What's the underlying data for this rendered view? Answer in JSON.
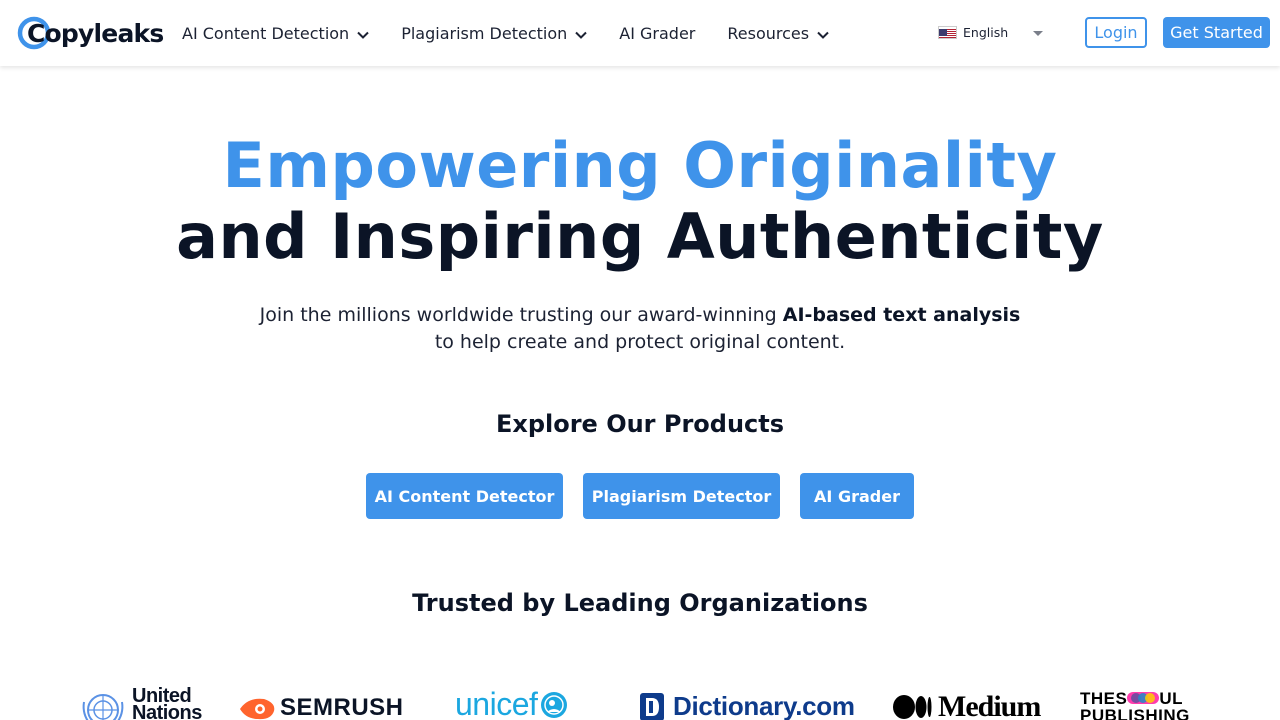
{
  "brand": {
    "name": "Copyleaks",
    "accent_color": "#3f93ea",
    "text_color": "#0b1426"
  },
  "nav": {
    "items": [
      {
        "label": "AI Content Detection",
        "has_dropdown": true,
        "icon": "chevron-down-icon"
      },
      {
        "label": "Plagiarism Detection",
        "has_dropdown": true,
        "icon": "chevron-down-icon"
      },
      {
        "label": "AI Grader",
        "has_dropdown": false
      },
      {
        "label": "Resources",
        "has_dropdown": true,
        "icon": "chevron-down-icon"
      }
    ],
    "language": {
      "label": "English",
      "icon": "us-flag-icon"
    },
    "login_label": "Login",
    "get_started_label": "Get Started"
  },
  "hero": {
    "title_line1": "Empowering Originality",
    "title_line2": "and Inspiring Authenticity",
    "subtitle_pre": "Join the millions worldwide trusting our award-winning ",
    "subtitle_bold": "AI-based text analysis",
    "subtitle_line2": "to help create and protect original content."
  },
  "products": {
    "heading": "Explore Our Products",
    "buttons": [
      {
        "label": "AI Content Detector"
      },
      {
        "label": "Plagiarism Detector"
      },
      {
        "label": "AI Grader"
      }
    ]
  },
  "trusted": {
    "heading": "Trusted by Leading Organizations",
    "logos": [
      {
        "name": "United Nations",
        "line1": "United",
        "line2": "Nations"
      },
      {
        "name": "Semrush",
        "text": "SEMRUSH"
      },
      {
        "name": "UNICEF",
        "text": "unicef"
      },
      {
        "name": "Dictionary.com",
        "text": "Dictionary.com"
      },
      {
        "name": "Medium",
        "text": "Medium"
      },
      {
        "name": "The Soul Publishing",
        "line1a": "THES",
        "line1b": "UL",
        "line2": "PUBLISHING"
      }
    ]
  }
}
